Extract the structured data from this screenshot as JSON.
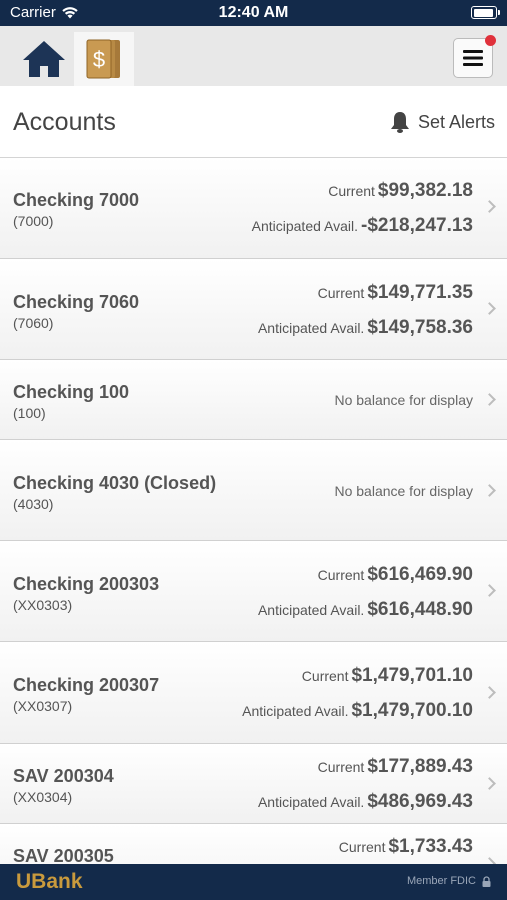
{
  "status_bar": {
    "carrier": "Carrier",
    "time": "12:40 AM",
    "battery_level": 0.95
  },
  "nav": {
    "tabs": [
      "home",
      "accounts"
    ],
    "active_tab": "accounts",
    "has_notification": true
  },
  "header": {
    "title": "Accounts",
    "alerts_label": "Set Alerts"
  },
  "accounts": [
    {
      "name": "Checking 7000",
      "number": "(7000)",
      "current_label": "Current",
      "current": "$99,382.18",
      "avail_label": "Anticipated Avail.",
      "avail": "-$218,247.13"
    },
    {
      "name": "Checking 7060",
      "number": "(7060)",
      "current_label": "Current",
      "current": "$149,771.35",
      "avail_label": "Anticipated Avail.",
      "avail": "$149,758.36"
    },
    {
      "name": "Checking 100",
      "number": "(100)",
      "no_balance": "No balance for display"
    },
    {
      "name": "Checking 4030 (Closed)",
      "number": "(4030)",
      "no_balance": "No balance for display"
    },
    {
      "name": "Checking 200303",
      "number": "(XX0303)",
      "current_label": "Current",
      "current": "$616,469.90",
      "avail_label": "Anticipated Avail.",
      "avail": "$616,448.90"
    },
    {
      "name": "Checking 200307",
      "number": "(XX0307)",
      "current_label": "Current",
      "current": "$1,479,701.10",
      "avail_label": "Anticipated Avail.",
      "avail": "$1,479,700.10"
    },
    {
      "name": "SAV 200304",
      "number": "(XX0304)",
      "current_label": "Current",
      "current": "$177,889.43",
      "avail_label": "Anticipated Avail.",
      "avail": "$486,969.43"
    },
    {
      "name": "SAV 200305",
      "number": "",
      "current_label": "Current",
      "current": "$1,733.43"
    }
  ],
  "footer": {
    "brand": "UBank",
    "fdic": "Member FDIC"
  },
  "colors": {
    "header_bg": "#132a4a",
    "accent_gold": "#c99a3d",
    "notification": "#e0313b"
  }
}
